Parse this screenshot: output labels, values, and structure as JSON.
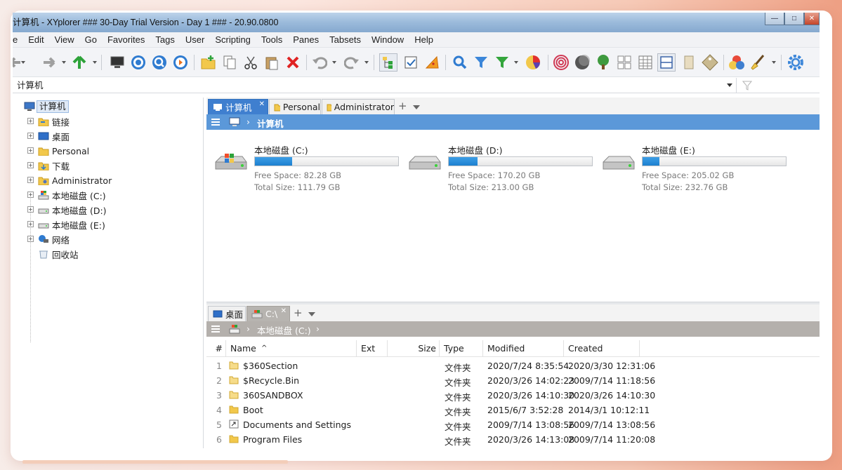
{
  "window": {
    "title": "计算机 - XYplorer ### 30-Day Trial Version - Day 1 ### - 20.90.0800"
  },
  "menu": [
    "e",
    "Edit",
    "View",
    "Go",
    "Favorites",
    "Tags",
    "User",
    "Scripting",
    "Tools",
    "Panes",
    "Tabsets",
    "Window",
    "Help"
  ],
  "toolbar_icons": [
    "back-arrow-icon",
    "forward-arrow-icon",
    "up-arrow-icon",
    "computer-icon",
    "target-icon",
    "find-circle-icon",
    "play-circle-icon",
    "new-folder-icon",
    "copy-icon",
    "cut-icon",
    "paste-icon",
    "delete-icon",
    "undo-icon",
    "redo-icon",
    "tree-icon",
    "checkbox-icon",
    "pie-slice-icon",
    "search-icon",
    "filter-icon",
    "green-filter-icon",
    "pie-chart-icon",
    "spiral-icon",
    "moon-icon",
    "tree-view-icon",
    "grid-icon",
    "details-grid-icon",
    "split-horizontal-icon",
    "panel-icon",
    "tag-icon",
    "color-balls-icon",
    "brush-icon",
    "settings-gear-icon"
  ],
  "address": {
    "value": "计算机"
  },
  "tree": {
    "root": "计算机",
    "items": [
      {
        "label": "链接",
        "icon": "link-folder-icon",
        "expandable": true
      },
      {
        "label": "桌面",
        "icon": "desktop-icon",
        "expandable": true
      },
      {
        "label": "Personal",
        "icon": "folder-icon",
        "expandable": true
      },
      {
        "label": "下载",
        "icon": "download-folder-icon",
        "expandable": true
      },
      {
        "label": "Administrator",
        "icon": "user-folder-icon",
        "expandable": true
      },
      {
        "label": "本地磁盘 (C:)",
        "icon": "system-drive-icon",
        "expandable": true
      },
      {
        "label": "本地磁盘 (D:)",
        "icon": "drive-icon",
        "expandable": true
      },
      {
        "label": "本地磁盘 (E:)",
        "icon": "drive-icon",
        "expandable": true
      },
      {
        "label": "网络",
        "icon": "network-icon",
        "expandable": true
      },
      {
        "label": "回收站",
        "icon": "recycle-bin-icon",
        "expandable": false
      }
    ]
  },
  "pane1": {
    "tabs": [
      "计算机",
      "Personal",
      "Administrator"
    ],
    "breadcrumb": "计算机",
    "drives": [
      {
        "name": "本地磁盘 (C:)",
        "free": "Free Space: 82.28 GB",
        "total": "Total Size: 111.79 GB",
        "used_fraction": 0.26
      },
      {
        "name": "本地磁盘 (D:)",
        "free": "Free Space: 170.20 GB",
        "total": "Total Size: 213.00 GB",
        "used_fraction": 0.2
      },
      {
        "name": "本地磁盘 (E:)",
        "free": "Free Space: 205.02 GB",
        "total": "Total Size: 232.76 GB",
        "used_fraction": 0.12
      }
    ]
  },
  "pane2": {
    "tabs": [
      "桌面",
      "C:\\"
    ],
    "breadcrumb": "本地磁盘 (C:)",
    "columns": {
      "num": "#",
      "name": "Name",
      "ext": "Ext",
      "size": "Size",
      "type": "Type",
      "modified": "Modified",
      "created": "Created"
    },
    "rows": [
      {
        "num": "1",
        "name": "$360Section",
        "type": "文件夹",
        "modified": "2020/7/24 8:35:54",
        "created": "2020/3/30 12:31:06"
      },
      {
        "num": "2",
        "name": "$Recycle.Bin",
        "type": "文件夹",
        "modified": "2020/3/26 14:02:23",
        "created": "2009/7/14 11:18:56"
      },
      {
        "num": "3",
        "name": "360SANDBOX",
        "type": "文件夹",
        "modified": "2020/3/26 14:10:30",
        "created": "2020/3/26 14:10:30"
      },
      {
        "num": "4",
        "name": "Boot",
        "type": "文件夹",
        "modified": "2015/6/7 3:52:28",
        "created": "2014/3/1 10:12:11"
      },
      {
        "num": "5",
        "name": "Documents and Settings",
        "type": "文件夹",
        "modified": "2009/7/14 13:08:56",
        "created": "2009/7/14 13:08:56"
      },
      {
        "num": "6",
        "name": "Program Files",
        "type": "文件夹",
        "modified": "2020/3/26 14:13:08",
        "created": "2009/7/14 11:20:08"
      }
    ]
  }
}
